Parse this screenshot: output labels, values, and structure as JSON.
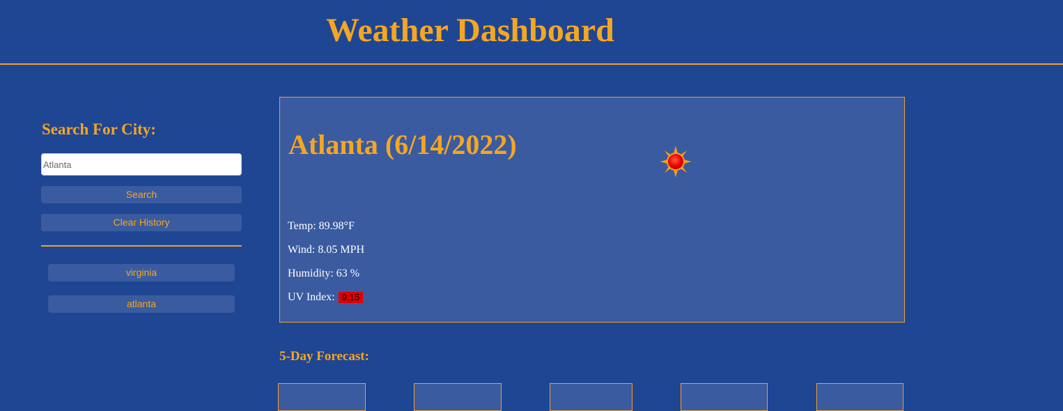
{
  "header": {
    "title": "Weather Dashboard"
  },
  "sidebar": {
    "title": "Search For City:",
    "search_input": {
      "value": "",
      "placeholder": "Atlanta"
    },
    "search_label": "Search",
    "clear_label": "Clear History",
    "history": [
      "virginia",
      "atlanta"
    ]
  },
  "current": {
    "heading": "Atlanta (6/14/2022)",
    "icon": "sun-icon",
    "temp": "Temp: 89.98°F",
    "wind": "Wind: 8.05 MPH",
    "humidity": "Humidity: 63 %",
    "uv_label": "UV Index: ",
    "uv_value": "9.15",
    "uv_color": "#e00000"
  },
  "forecast": {
    "title": "5-Day Forecast:",
    "cards": [
      {},
      {},
      {},
      {},
      {}
    ]
  },
  "colors": {
    "background": "#1f4693",
    "panel": "#3a5ba0",
    "accent": "#f5a623"
  }
}
